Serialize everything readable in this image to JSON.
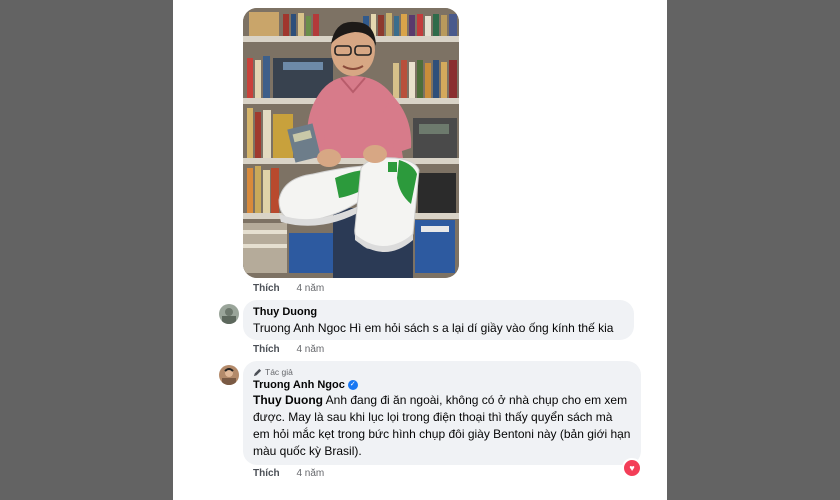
{
  "post_image": {
    "icon": "photo-of-man-holding-sneakers"
  },
  "comments": [
    {
      "like_label": "Thích",
      "time": "4 năm"
    },
    {
      "author": "Thuy Duong",
      "mention": "Truong Anh Ngoc",
      "text": " Hì em hỏi sách s a lại dí giầy vào ống kính thế kia",
      "like_label": "Thích",
      "time": "4 năm"
    },
    {
      "author_badge": "Tác giả",
      "author": "Truong Anh Ngoc",
      "mention": "Thuy Duong",
      "text": " Anh đang đi ăn ngoài, không có ở nhà chụp cho em xem được. May là sau khi lục lọi trong điện thoại thì thấy quyển sách mà em hỏi mắc kẹt trong bức hình chụp đôi giày Bentoni này (bản giới hạn màu quốc kỳ Brasil).",
      "like_label": "Thích",
      "time": "4 năm",
      "reaction_icon": "heart-icon"
    }
  ]
}
